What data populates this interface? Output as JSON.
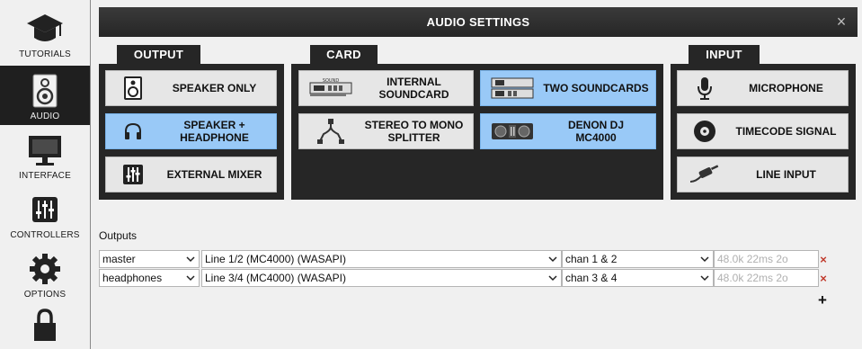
{
  "sidebar": {
    "items": [
      {
        "label": "TUTORIALS",
        "icon": "graduation-cap-icon",
        "active": false
      },
      {
        "label": "AUDIO",
        "icon": "speaker-icon",
        "active": true
      },
      {
        "label": "INTERFACE",
        "icon": "monitor-icon",
        "active": false
      },
      {
        "label": "CONTROLLERS",
        "icon": "mixer-sliders-icon",
        "active": false
      },
      {
        "label": "OPTIONS",
        "icon": "gear-icon",
        "active": false
      },
      {
        "label": "",
        "icon": "lock-icon",
        "active": false
      }
    ]
  },
  "header": {
    "title": "AUDIO SETTINGS",
    "close": "×"
  },
  "output": {
    "tab": "OUTPUT",
    "buttons": [
      {
        "label": "SPEAKER ONLY",
        "icon": "speaker-icon",
        "selected": false
      },
      {
        "label": "SPEAKER +\nHEADPHONE",
        "icon": "headphones-icon",
        "selected": true
      },
      {
        "label": "EXTERNAL MIXER",
        "icon": "mixer-icon",
        "selected": false
      }
    ]
  },
  "card": {
    "tab": "CARD",
    "buttons": [
      {
        "label": "INTERNAL\nSOUNDCARD",
        "icon": "internal-soundcard-icon",
        "selected": false
      },
      {
        "label": "TWO SOUNDCARDS",
        "icon": "two-soundcards-icon",
        "selected": true
      },
      {
        "label": "STEREO TO MONO\nSPLITTER",
        "icon": "splitter-cable-icon",
        "selected": false
      },
      {
        "label": "DENON DJ\nMC4000",
        "icon": "dj-controller-icon",
        "selected": true
      }
    ]
  },
  "input": {
    "tab": "INPUT",
    "buttons": [
      {
        "label": "MICROPHONE",
        "icon": "microphone-icon",
        "selected": false
      },
      {
        "label": "TIMECODE SIGNAL",
        "icon": "vinyl-icon",
        "selected": false
      },
      {
        "label": "LINE INPUT",
        "icon": "cable-plug-icon",
        "selected": false
      }
    ]
  },
  "outputs": {
    "label": "Outputs",
    "rows": [
      {
        "name": "master",
        "device": "Line 1/2 (MC4000) (WASAPI)",
        "channels": "chan 1 & 2",
        "info": "48.0k 22ms 2o"
      },
      {
        "name": "headphones",
        "device": "Line 3/4 (MC4000) (WASAPI)",
        "channels": "chan 3 & 4",
        "info": "48.0k 22ms 2o"
      }
    ],
    "delete_glyph": "×",
    "add_glyph": "+"
  },
  "colors": {
    "selected": "#99c9f7",
    "panel": "#262626",
    "delete": "#c0392b"
  }
}
